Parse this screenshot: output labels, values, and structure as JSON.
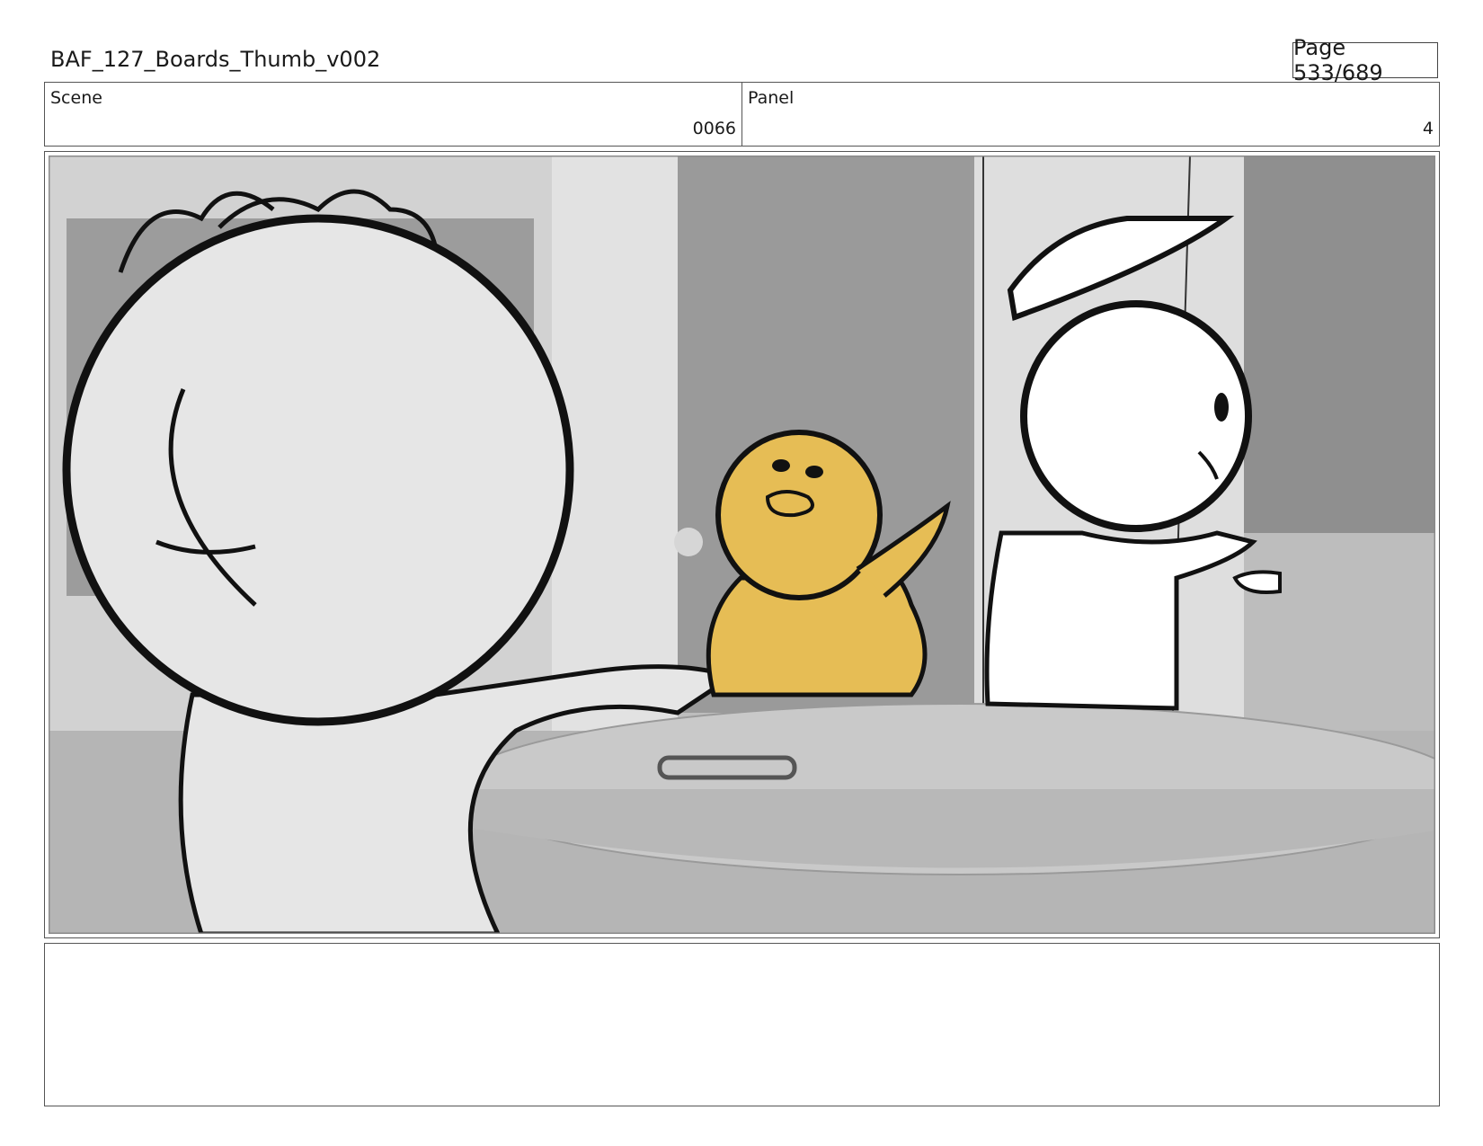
{
  "header": {
    "title": "BAF_127_Boards_Thumb_v002",
    "page": "Page 533/689"
  },
  "info": {
    "scene_label": "Scene",
    "scene_value": "0066",
    "panel_label": "Panel",
    "panel_value": "4"
  },
  "panel_art": {
    "icons": [
      "rabbit-character",
      "duck-character",
      "sailor-character",
      "round-table",
      "teacup"
    ],
    "colors": {
      "background": "#bdbdbd",
      "duck": "#e6bd55",
      "ink": "#111111",
      "table": "#c9c9c9"
    }
  },
  "notes": {
    "text": ""
  }
}
